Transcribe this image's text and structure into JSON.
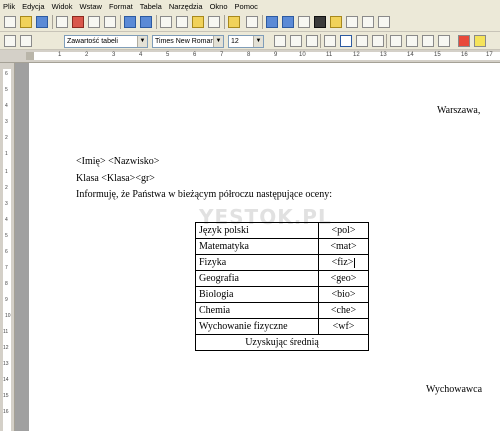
{
  "menu": [
    "Plik",
    "Edycja",
    "Widok",
    "Wstaw",
    "Format",
    "Tabela",
    "Narzędzia",
    "Okno",
    "Pomoc"
  ],
  "toolbar": {
    "style": "Zawartość tabeli",
    "font": "Times New Roman",
    "size": "12"
  },
  "icons": {
    "new": "new-document-icon",
    "open": "open-folder-icon",
    "save": "save-icon",
    "edit": "edit-icon",
    "pdf": "pdf-export-icon",
    "print": "print-icon",
    "preview": "page-preview-icon",
    "spell": "spellcheck-icon",
    "autospell": "autospell-icon",
    "cut": "cut-icon",
    "copy": "copy-icon",
    "paste": "paste-icon",
    "format_paint": "clone-formatting-icon",
    "undo": "undo-icon",
    "redo": "redo-icon",
    "hyperlink": "hyperlink-icon",
    "table": "table-icon",
    "show_draw": "draw-functions-icon",
    "navigator": "navigator-icon",
    "gallery": "gallery-icon",
    "datasource": "datasource-icon",
    "nonprint": "formatting-marks-icon",
    "zoom": "zoom-icon",
    "bold": "bold-icon",
    "italic": "italic-icon",
    "underline": "underline-icon",
    "align_left": "align-left-icon",
    "align_center": "align-center-icon",
    "align_right": "align-right-icon",
    "justify": "justify-icon",
    "numbering": "numbering-icon",
    "bullets": "bullets-icon",
    "outdent": "decrease-indent-icon",
    "indent": "increase-indent-icon",
    "font_color": "font-color-icon",
    "highlight": "highlight-icon",
    "bg_color": "background-color-icon"
  },
  "ruler": {
    "h_numbers": [
      "1",
      "2",
      "3",
      "4",
      "5",
      "6",
      "7",
      "8",
      "9",
      "10",
      "11",
      "12",
      "13",
      "14",
      "15",
      "16",
      "17"
    ],
    "v_numbers": [
      "6",
      "5",
      "4",
      "3",
      "2",
      "1",
      "1",
      "2",
      "3",
      "4",
      "5",
      "6",
      "7",
      "8",
      "9",
      "10",
      "11",
      "12",
      "13",
      "14",
      "15",
      "16",
      "17"
    ]
  },
  "document": {
    "city": "Warszawa,",
    "name": "<Imię> <Nazwisko>",
    "class": "Klasa <Klasa><gr>",
    "intro": "Informuję, że  Państwa  w bieżącym półroczu następujące oceny:",
    "watermark": "YESTOK.PL",
    "table": [
      {
        "subject": "Język polski",
        "grade": "<pol>"
      },
      {
        "subject": "Matematyka",
        "grade": "<mat>"
      },
      {
        "subject": "Fizyka",
        "grade": "<fiz>"
      },
      {
        "subject": "Geografia",
        "grade": "<geo>"
      },
      {
        "subject": "Biologia",
        "grade": "<bio>"
      },
      {
        "subject": "Chemia",
        "grade": "<che>"
      },
      {
        "subject": "Wychowanie fizyczne",
        "grade": "<wf>"
      }
    ],
    "average": "Uzyskując średnią",
    "signature": "Wychowawca"
  }
}
